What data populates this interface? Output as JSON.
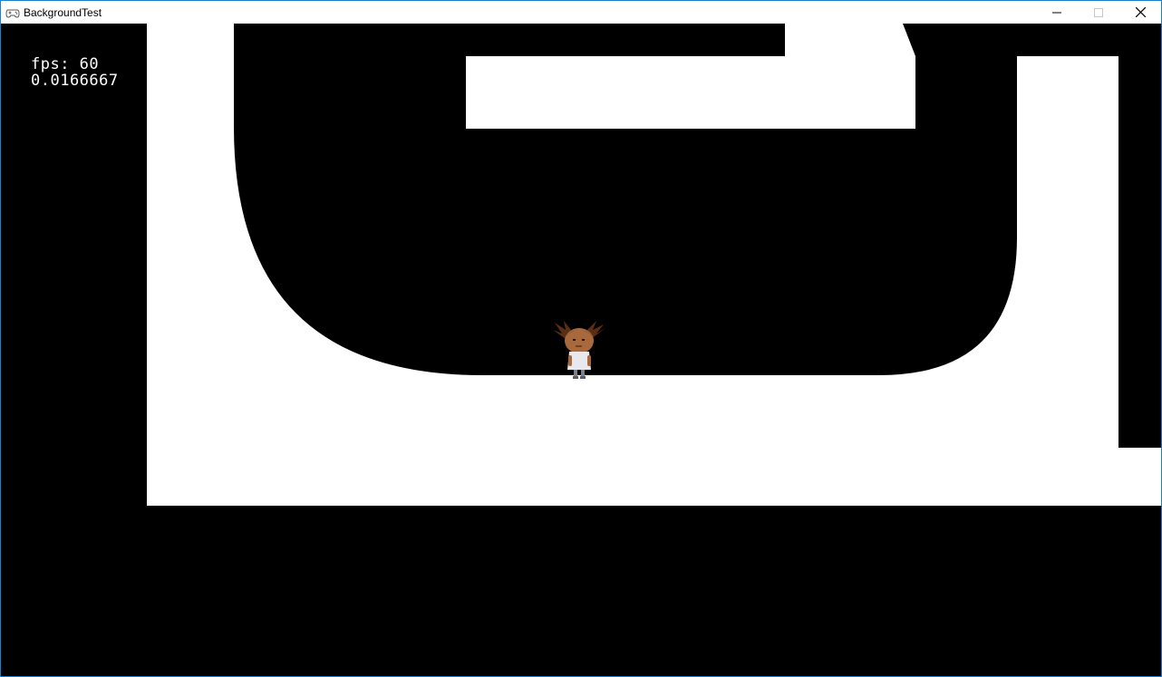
{
  "window": {
    "title": "BackgroundTest",
    "app_icon": "gamepad-icon",
    "controls": [
      "minimize-icon",
      "maximize-icon",
      "close-icon"
    ]
  },
  "hud": {
    "fps_label": "fps: 60",
    "frame_time": "0.0166667"
  },
  "scene": {
    "background_color": "#000000",
    "track_color": "#ffffff",
    "player": "girl-with-pigtails-sprite"
  }
}
